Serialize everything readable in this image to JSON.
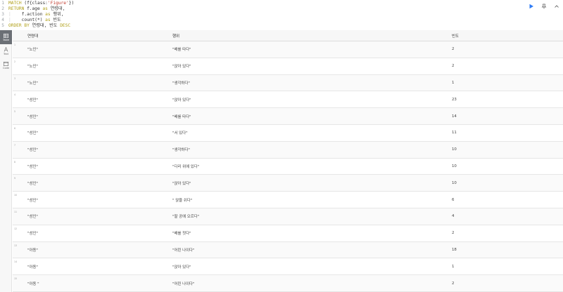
{
  "editor": {
    "lines": [
      {
        "num": "1",
        "tokens": [
          {
            "t": "kw",
            "v": "MATCH"
          },
          {
            "t": "txt",
            "v": " (f{class:"
          },
          {
            "t": "str",
            "v": "'Figure'"
          },
          {
            "t": "txt",
            "v": "})"
          }
        ]
      },
      {
        "num": "2",
        "tokens": [
          {
            "t": "kw",
            "v": "RETURN"
          },
          {
            "t": "txt",
            "v": " f.age "
          },
          {
            "t": "kw",
            "v": "as"
          },
          {
            "t": "txt",
            "v": " 연령대,"
          }
        ]
      },
      {
        "num": "3",
        "tokens": [
          {
            "t": "guide",
            "v": "|    "
          },
          {
            "t": "txt",
            "v": "f.action "
          },
          {
            "t": "kw",
            "v": "as"
          },
          {
            "t": "txt",
            "v": " 행위,"
          }
        ]
      },
      {
        "num": "4",
        "tokens": [
          {
            "t": "guide",
            "v": "|    "
          },
          {
            "t": "txt",
            "v": "count(*) "
          },
          {
            "t": "kw",
            "v": "as"
          },
          {
            "t": "txt",
            "v": " 빈도"
          }
        ]
      },
      {
        "num": "5",
        "tokens": [
          {
            "t": "kw",
            "v": "ORDER BY"
          },
          {
            "t": "txt",
            "v": " 연령대, 빈도 "
          },
          {
            "t": "kw",
            "v": "DESC"
          }
        ]
      }
    ]
  },
  "sidebar": {
    "items": [
      {
        "label": "Table",
        "icon": "table-icon",
        "active": true
      },
      {
        "label": "Text",
        "icon": "text-icon",
        "active": false
      },
      {
        "label": "Code",
        "icon": "code-icon",
        "active": false
      }
    ]
  },
  "table": {
    "headers": [
      "연령대",
      "행위",
      "빈도"
    ],
    "rows": [
      {
        "n": "1",
        "c": [
          "\"노인\"",
          "\"배를 타다\"",
          "2"
        ]
      },
      {
        "n": "2",
        "c": [
          "\"노인\"",
          "\"앉아 있다\"",
          "2"
        ]
      },
      {
        "n": "3",
        "c": [
          "\"노인\"",
          "\"생각하다\"",
          "1"
        ]
      },
      {
        "n": "4",
        "c": [
          "\"성인\"",
          "\"앉아 있다\"",
          "23"
        ]
      },
      {
        "n": "5",
        "c": [
          "\"성인\"",
          "\"배를 타다\"",
          "14"
        ]
      },
      {
        "n": "6",
        "c": [
          "\"성인\"",
          "\"서 있다\"",
          "11"
        ]
      },
      {
        "n": "7",
        "c": [
          "\"성인\"",
          "\"생각하다\"",
          "10"
        ]
      },
      {
        "n": "8",
        "c": [
          "\"성인\"",
          "\"다리 위에 있다\"",
          "10"
        ]
      },
      {
        "n": "9",
        "c": [
          "\"성인\"",
          "\"앉아 있다\"",
          "10"
        ]
      },
      {
        "n": "10",
        "c": [
          "\"성인\"",
          "\" 앉을 쉬다\"",
          "6"
        ]
      },
      {
        "n": "11",
        "c": [
          "\"성인\"",
          "\"팔 공에 오르다\"",
          "4"
        ]
      },
      {
        "n": "12",
        "c": [
          "\"성인\"",
          "\"배를 젓다\"",
          "2"
        ]
      },
      {
        "n": "13",
        "c": [
          "\"아동\"",
          "\"어린 나이다\"",
          "18"
        ]
      },
      {
        "n": "14",
        "c": [
          "\"아동\"",
          "\"앉아 있다\"",
          "1"
        ]
      },
      {
        "n": "15",
        "c": [
          "\"아동 \"",
          "\"어린 나이다\"",
          "2"
        ]
      }
    ]
  },
  "colors": {
    "run": "#2f7cf6",
    "keyword": "#b0a018",
    "string": "#c0392b"
  }
}
